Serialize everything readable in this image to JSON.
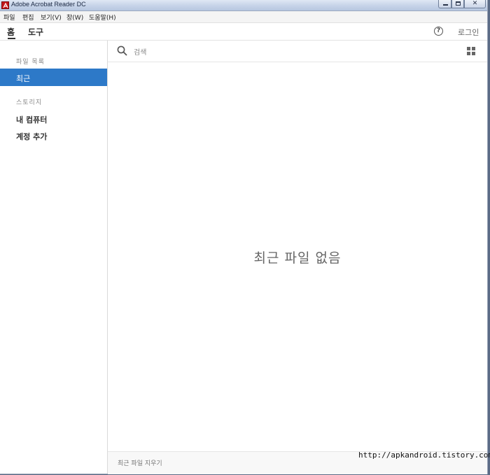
{
  "window": {
    "title": "Adobe Acrobat Reader DC"
  },
  "window_controls": {
    "minimize": "minimize",
    "maximize": "maximize",
    "close": "close"
  },
  "menu": [
    "파일",
    "편집",
    "보기(V)",
    "창(W)",
    "도움말(H)"
  ],
  "tabs": [
    {
      "label": "홈",
      "active": true
    },
    {
      "label": "도구",
      "active": false
    }
  ],
  "header": {
    "help_icon": "question-circle-icon",
    "help_glyph": "?",
    "login_label": "로그인"
  },
  "sidebar": {
    "files_heading": "파일 목록",
    "recent_label": "최근",
    "storage_heading": "스토리지",
    "my_computer_label": "내 컴퓨터",
    "add_account_label": "계정 추가"
  },
  "search": {
    "label": "검색"
  },
  "main": {
    "empty_message": "최근 파일 없음"
  },
  "footer": {
    "clear_recent_label": "최근 파일 지우기"
  },
  "watermark": "http://apkandroid.tistory.com",
  "colors": {
    "accent": "#2d79c8",
    "title_bar": "#c6d3e8",
    "app_icon": "#c4171b"
  }
}
